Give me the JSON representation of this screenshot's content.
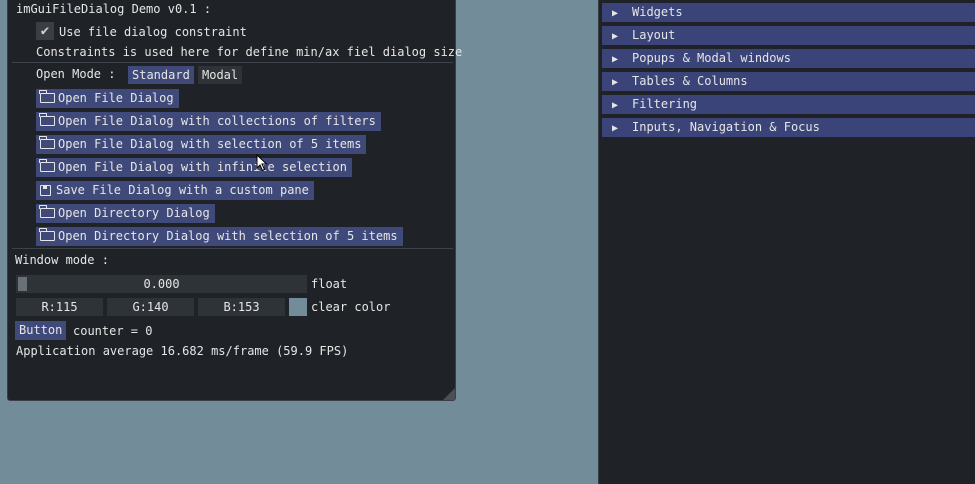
{
  "demo": {
    "title": "imGuiFileDialog Demo v0.1 :",
    "checkbox_label": "Use file dialog constraint",
    "constraints_text": "Constraints is used here for define min/ax fiel dialog size",
    "open_mode_label": "Open Mode :",
    "mode_standard": "Standard",
    "mode_modal": "Modal",
    "buttons": [
      "Open File Dialog",
      "Open File Dialog with collections of filters",
      "Open File Dialog with selection of 5 items",
      "Open File Dialog with infinite selection",
      "Save File Dialog with a custom pane",
      "Open Directory Dialog",
      "Open Directory Dialog with selection of 5 items"
    ],
    "window_mode_label": "Window mode :",
    "slider_value": "0.000",
    "slider_label": "float",
    "r": "R:115",
    "g": "G:140",
    "b": "B:153",
    "clear_color_label": "clear color",
    "clear_color": "#738c99",
    "button_label": "Button",
    "counter_text": "counter = 0",
    "fps_text": "Application average 16.682 ms/frame (59.9 FPS)"
  },
  "panel": {
    "headers": [
      "Widgets",
      "Layout",
      "Popups & Modal windows",
      "Tables & Columns",
      "Filtering",
      "Inputs, Navigation & Focus"
    ]
  },
  "colors": {
    "background": "#738c99",
    "window_bg": "#1f2226",
    "button": "#3f4a7a",
    "header": "#3b4478"
  }
}
